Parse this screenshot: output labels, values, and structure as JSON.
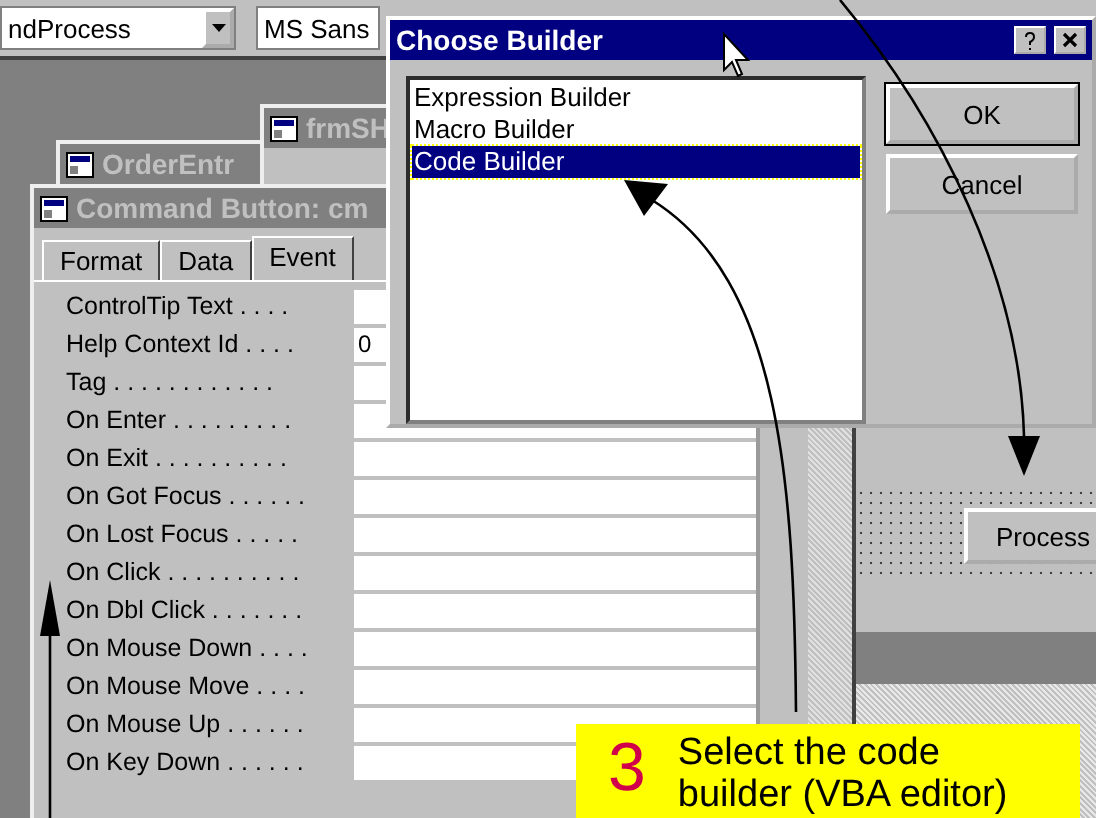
{
  "toolbar": {
    "object_combo": "ndProcess",
    "font_combo": "MS Sans"
  },
  "windows": [
    {
      "title": "frmSH"
    },
    {
      "title": "OrderEntr"
    }
  ],
  "property_sheet": {
    "title": "Command Button: cm",
    "tabs": [
      {
        "label": "Format",
        "selected": false
      },
      {
        "label": "Data",
        "selected": false
      },
      {
        "label": "Event",
        "selected": true
      }
    ],
    "rows": [
      {
        "label": "ControlTip Text . . . ."
      },
      {
        "label": "Help Context Id . . . .",
        "value": "0"
      },
      {
        "label": "Tag . . . . . . . . . . . ."
      },
      {
        "label": "On Enter . . . . . . . . ."
      },
      {
        "label": "On Exit . . . . . . . . . ."
      },
      {
        "label": "On Got Focus . . . . . ."
      },
      {
        "label": "On Lost Focus . . . . ."
      },
      {
        "label": "On Click . . . . . . . . . ."
      },
      {
        "label": "On Dbl Click . . . . . . ."
      },
      {
        "label": "On Mouse Down . . . ."
      },
      {
        "label": "On Mouse Move . . . ."
      },
      {
        "label": "On Mouse Up . . . . . ."
      },
      {
        "label": "On Key Down . . . . . ."
      }
    ]
  },
  "dialog": {
    "title": "Choose Builder",
    "options": [
      {
        "label": "Expression Builder",
        "selected": false
      },
      {
        "label": "Macro Builder",
        "selected": false
      },
      {
        "label": "Code Builder",
        "selected": true
      }
    ],
    "buttons": [
      "OK",
      "Cancel"
    ]
  },
  "form_design": {
    "button": "Process"
  },
  "callout": {
    "number": "3",
    "text": "Select the code builder (VBA editor)"
  }
}
